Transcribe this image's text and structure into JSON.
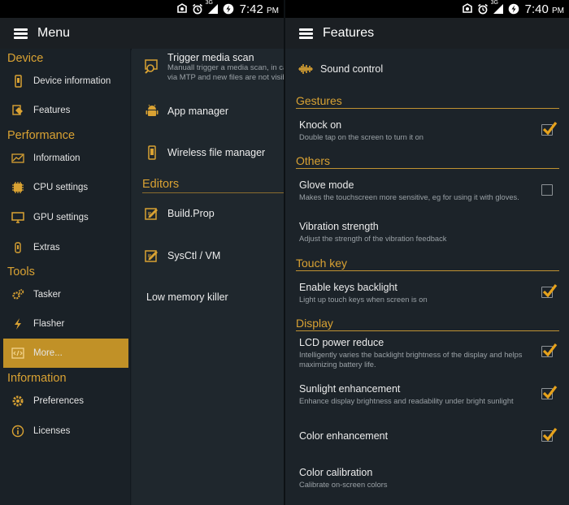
{
  "colors": {
    "accent": "#d9a233",
    "active_bg": "#c19127",
    "background": "#1c2329",
    "statusbar": "#000000"
  },
  "left": {
    "status": {
      "time": "7:42",
      "ampm": "PM",
      "network": "3G",
      "icons": [
        "ring-icon",
        "alarm-icon",
        "signal-icon",
        "data-saver-icon"
      ]
    },
    "appbar": {
      "title": "Menu"
    },
    "drawer": {
      "sections": {
        "device": "Device",
        "performance": "Performance",
        "tools": "Tools",
        "information": "Information"
      },
      "items": {
        "device_information": "Device information",
        "features": "Features",
        "information": "Information",
        "cpu_settings": "CPU settings",
        "gpu_settings": "GPU settings",
        "extras": "Extras",
        "tasker": "Tasker",
        "flasher": "Flasher",
        "more": "More...",
        "preferences": "Preferences",
        "licenses": "Licenses"
      }
    },
    "more_panel": {
      "trigger_media_scan": {
        "title": "Trigger media scan",
        "subtitle_1": "Manuall trigger a media scan, in cas",
        "subtitle_2": "via MTP and new files are not visib"
      },
      "app_manager": "App manager",
      "wireless_file_manager": "Wireless file manager",
      "editors_section": "Editors",
      "build_prop": "Build.Prop",
      "sysctl_vm": "SysCtl / VM",
      "low_memory_killer": "Low memory killer"
    }
  },
  "right": {
    "status": {
      "time": "7:40",
      "ampm": "PM",
      "network": "3G"
    },
    "appbar": {
      "title": "Features"
    },
    "sound_control": "Sound control",
    "sections": {
      "gestures": "Gestures",
      "others": "Others",
      "touch_key": "Touch key",
      "display": "Display"
    },
    "rows": {
      "knock_on": {
        "title": "Knock on",
        "subtitle": "Double tap on the screen to turn it on",
        "checked": true
      },
      "glove_mode": {
        "title": "Glove mode",
        "subtitle": "Makes the touchscreen more sensitive, eg for using it with gloves.",
        "checked": false
      },
      "vibration_strength": {
        "title": "Vibration strength",
        "subtitle": "Adjust the strength of the vibration feedback"
      },
      "keys_backlight": {
        "title": "Enable keys backlight",
        "subtitle": "Light up touch keys when screen is on",
        "checked": true
      },
      "lcd_power_reduce": {
        "title": "LCD power reduce",
        "subtitle": "Intelligently varies the backlight brightness of the display and helps maximizing battery life.",
        "checked": true
      },
      "sunlight_enhancement": {
        "title": "Sunlight enhancement",
        "subtitle": "Enhance display brightness and readability under bright sunlight",
        "checked": true
      },
      "color_enhancement": {
        "title": "Color enhancement",
        "checked": true
      },
      "color_calibration": {
        "title": "Color calibration",
        "subtitle": "Calibrate on-screen colors"
      }
    }
  }
}
